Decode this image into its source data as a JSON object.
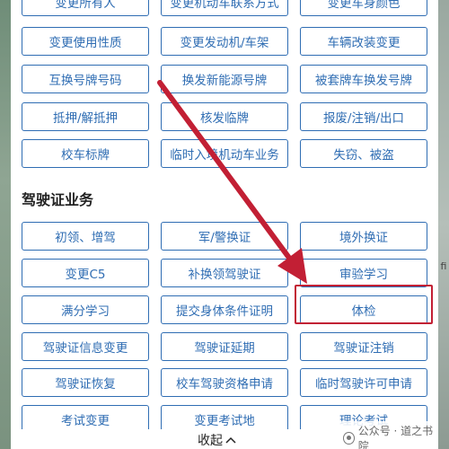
{
  "vehicle_rows": [
    [
      "变更所有人",
      "变更机动车联系方式",
      "变更车身颜色"
    ],
    [
      "变更使用性质",
      "变更发动机/车架",
      "车辆改装变更"
    ],
    [
      "互换号牌号码",
      "换发新能源号牌",
      "被套牌车换发号牌"
    ],
    [
      "抵押/解抵押",
      "核发临牌",
      "报废/注销/出口"
    ],
    [
      "校车标牌",
      "临时入境机动车业务",
      "失窃、被盗"
    ]
  ],
  "license_section": {
    "title": "驾驶证业务",
    "rows": [
      [
        "初领、增驾",
        "军/警换证",
        "境外换证"
      ],
      [
        "变更C5",
        "补换领驾驶证",
        "审验学习"
      ],
      [
        "满分学习",
        "提交身体条件证明",
        "体检"
      ],
      [
        "驾驶证信息变更",
        "驾驶证延期",
        "驾驶证注销"
      ],
      [
        "驾驶证恢复",
        "校车驾驶资格申请",
        "临时驾驶许可申请"
      ],
      [
        "考试变更",
        "变更考试地",
        "理论考试"
      ]
    ]
  },
  "footer": {
    "collapse_label": "收起"
  },
  "watermark": {
    "text": "公众号 · 道之书院"
  },
  "map_edge_label": "fi",
  "colors": {
    "accent": "#2f6db3",
    "highlight": "#c21f34",
    "arrow": "#c21f34"
  }
}
